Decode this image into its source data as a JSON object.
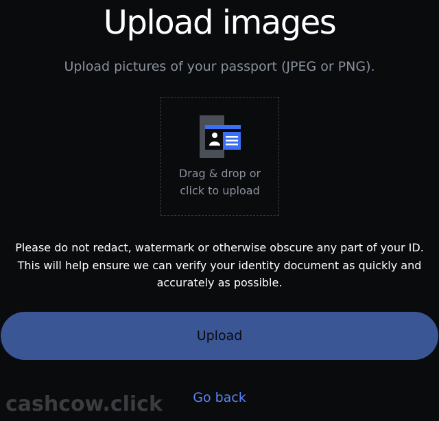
{
  "header": {
    "title": "Upload images",
    "subtitle": "Upload pictures of your passport (JPEG or PNG)."
  },
  "dropzone": {
    "icon": "id-card-icon",
    "line1": "Drag & drop or",
    "line2": "click to upload"
  },
  "notice": {
    "line1": "Please do not redact, watermark or otherwise obscure any part of your ID.",
    "line2": "This will help ensure we can verify your identity document as quickly and",
    "line3": "accurately as possible."
  },
  "actions": {
    "upload_label": "Upload",
    "go_back_label": "Go back"
  },
  "watermark": "cashcow.click",
  "colors": {
    "background": "#0a0b0d",
    "button": "#3a5694",
    "link": "#5b83f5",
    "muted_text": "#8a919e",
    "icon_accent": "#3b6ff5"
  }
}
